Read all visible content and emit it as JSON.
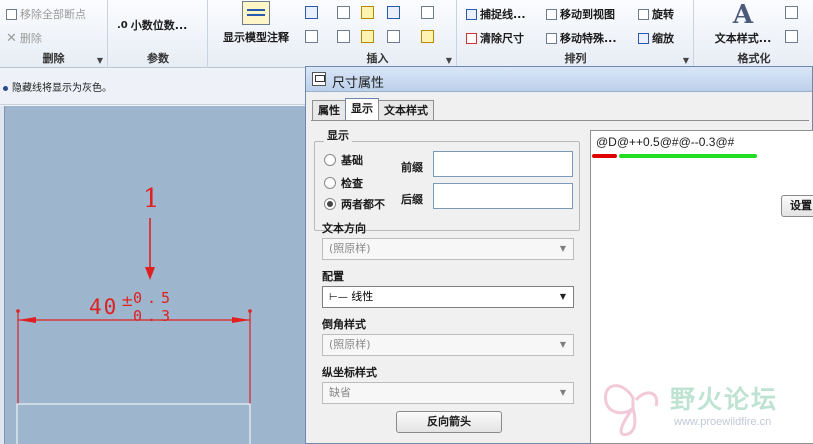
{
  "ribbon": {
    "delete_group": {
      "remove_all_breakpoints": "移除全部断点",
      "delete": "删除",
      "label": "删除"
    },
    "params_group": {
      "decimal_places": "小数位数...",
      "label": "参数"
    },
    "insert_group": {
      "show_model_annotation": "显示模型注释",
      "label": "插入"
    },
    "arrange_group": {
      "snap_lines": "捕捉线...",
      "move_to_view": "移动到视图",
      "rotate": "旋转",
      "clean_dims": "清除尺寸",
      "move_special": "移动特殊...",
      "zoom": "缩放",
      "label": "排列"
    },
    "format_group": {
      "text_style": "文本样式...",
      "label": "格式化"
    }
  },
  "message": "隐藏线将显示为灰色。",
  "drawing": {
    "callout_number": "1",
    "dimension_main": "40",
    "tol_upper": "0.5",
    "tol_lower": "0.3"
  },
  "dialog": {
    "title": "尺寸属性",
    "tabs": [
      "属性",
      "显示",
      "文本样式"
    ],
    "active_tab": "显示",
    "display_group_title": "显示",
    "radios": [
      "基础",
      "检查",
      "两者都不"
    ],
    "selected_radio": "两者都不",
    "prefix_label": "前缀",
    "suffix_label": "后缀",
    "prefix_value": "",
    "suffix_value": "",
    "text_direction_label": "文本方向",
    "text_direction_value": "(照原样)",
    "config_label": "配置",
    "config_value": "线性",
    "chamfer_style_label": "倒角样式",
    "chamfer_style_value": "(照原样)",
    "ordinate_style_label": "纵坐标样式",
    "ordinate_style_value": "缺省",
    "reverse_arrow_button": "反向箭头",
    "dim_text": "@D@++0.5@#@--0.3@#",
    "settings_button": "设置"
  },
  "watermark": {
    "text": "野火论坛",
    "url": "www.proewildfire.cn"
  },
  "colors": {
    "dim_red": "#e02020",
    "underline_red": "#e00000",
    "underline_green": "#22dd22",
    "canvas_bg": "#9db5cd"
  }
}
